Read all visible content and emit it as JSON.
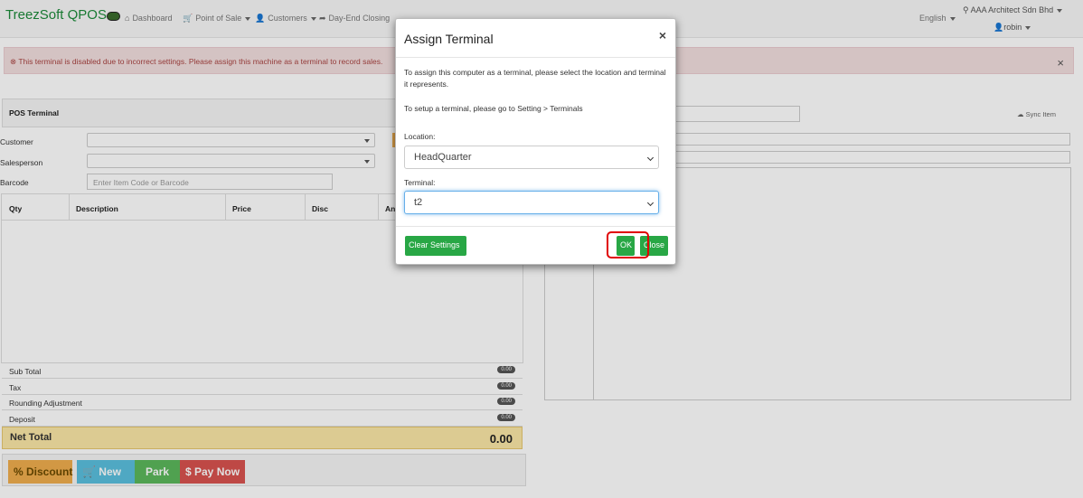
{
  "navbar": {
    "brand": "TreezSoft QPOS",
    "items": [
      {
        "icon": "home-icon",
        "glyph": "⌂",
        "label": "Dashboard"
      },
      {
        "icon": "cart-icon",
        "glyph": "🛒",
        "label": "Point of Sale"
      },
      {
        "icon": "user-icon",
        "glyph": "👤",
        "label": "Customers"
      },
      {
        "icon": "share-icon",
        "glyph": "➦",
        "label": "Day-End Closing"
      }
    ],
    "language": "English",
    "company": "AAA Architect Sdn Bhd",
    "user": "robin"
  },
  "alert": {
    "message": "This terminal is disabled due to incorrect settings. Please assign this machine as a terminal to record sales.",
    "close": "×"
  },
  "pos": {
    "panel_title": "POS Terminal",
    "customer_label": "Customer",
    "salesperson_label": "Salesperson",
    "barcode_label": "Barcode",
    "barcode_placeholder": "Enter Item Code or Barcode",
    "columns": [
      "Qty",
      "Description",
      "Price",
      "Disc",
      "An"
    ],
    "totals": [
      {
        "label": "Sub Total",
        "value": "0.00"
      },
      {
        "label": "Tax",
        "value": "0.00"
      },
      {
        "label": "Rounding Adjustment",
        "value": "0.00"
      },
      {
        "label": "Deposit",
        "value": "0.00"
      }
    ],
    "net_total_label": "Net Total",
    "net_total_value": "0.00",
    "buttons": {
      "discount": "% Discount",
      "new": "🛒 New",
      "park": "Park",
      "pay": "$ Pay Now"
    },
    "sync_label": "Sync Item"
  },
  "modal": {
    "title": "Assign Terminal",
    "close": "×",
    "intro": "To assign this computer as a terminal, please select the location and terminal it represents.",
    "setup": "To setup a terminal, please go to Setting > Terminals",
    "location_label": "Location:",
    "location_value": "HeadQuarter",
    "terminal_label": "Terminal:",
    "terminal_value": "t2",
    "clear_button": "Clear Settings",
    "ok_button": "OK",
    "close_button": "Close"
  },
  "colors": {
    "brand": "#1c8a3a",
    "ok": "#28a745",
    "alert_bg": "#f2dede",
    "highlight": "#e00000"
  }
}
